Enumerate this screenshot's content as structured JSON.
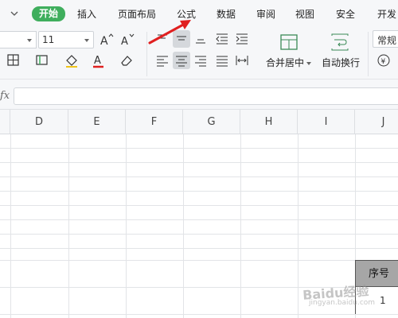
{
  "tabs": [
    "开始",
    "插入",
    "页面布局",
    "公式",
    "数据",
    "审阅",
    "视图",
    "安全",
    "开发"
  ],
  "active_tab_index": 0,
  "toolbar": {
    "font_size": "11",
    "merge_center_label": "合并居中",
    "wrap_text_label": "自动换行",
    "number_format": "常规"
  },
  "formula_bar": {
    "fx_label": "fx",
    "value": ""
  },
  "columns": [
    "D",
    "E",
    "F",
    "G",
    "H",
    "I",
    "J"
  ],
  "cells": {
    "header_text": "序号",
    "first_value": "1"
  },
  "colors": {
    "active_tab": "#3fae5d",
    "font_color_bar": "#e02020",
    "arrow": "#e02020",
    "header_fill": "#a6a6a6"
  },
  "watermark": {
    "text": "Baidu经验",
    "subtext": "jingyan.baidu.com"
  }
}
